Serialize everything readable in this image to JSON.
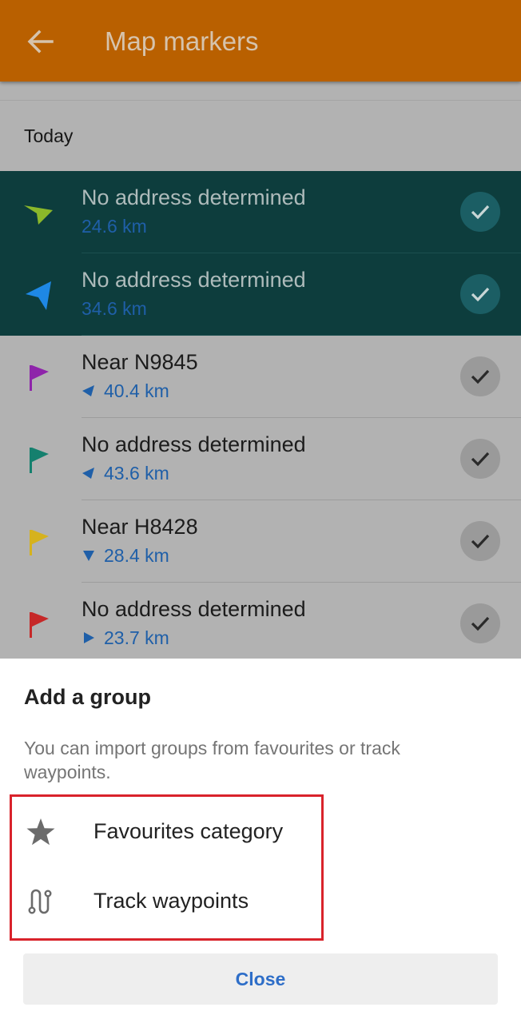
{
  "appbar": {
    "title": "Map markers",
    "back_icon": "arrow-left-icon"
  },
  "list": {
    "section_title": "Today",
    "items": [
      {
        "name": "No address determined",
        "distance": "24.6 km",
        "selected": true,
        "marker": "navigation-arrow-green",
        "marker_color": "#8bb82a",
        "direction": ""
      },
      {
        "name": "No address determined",
        "distance": "34.6 km",
        "selected": true,
        "marker": "navigation-arrow-blue",
        "marker_color": "#1e88e5",
        "direction": ""
      },
      {
        "name": "Near N9845",
        "distance": "40.4 km",
        "selected": false,
        "marker": "flag-purple",
        "marker_color": "#8e24aa",
        "direction": "arrow-left"
      },
      {
        "name": "No address determined",
        "distance": "43.6 km",
        "selected": false,
        "marker": "flag-teal",
        "marker_color": "#15806e",
        "direction": "arrow-left"
      },
      {
        "name": "Near H8428",
        "distance": "28.4 km",
        "selected": false,
        "marker": "flag-yellow",
        "marker_color": "#d6b21d",
        "direction": "arrow-down"
      },
      {
        "name": "No address determined",
        "distance": "23.7 km",
        "selected": false,
        "marker": "flag-red",
        "marker_color": "#c62828",
        "direction": "arrow-right"
      }
    ]
  },
  "sheet": {
    "heading": "Add a group",
    "description": "You can import groups from favourites or track waypoints.",
    "options": [
      {
        "label": "Favourites category",
        "icon": "star-icon"
      },
      {
        "label": "Track waypoints",
        "icon": "route-icon"
      }
    ],
    "close_label": "Close"
  },
  "colors": {
    "appbar": "#b96000",
    "selected_row": "#0d3d3d",
    "distance_text": "#1f5fa8",
    "highlight": "#d9232b",
    "close_text": "#2e6ec8"
  }
}
